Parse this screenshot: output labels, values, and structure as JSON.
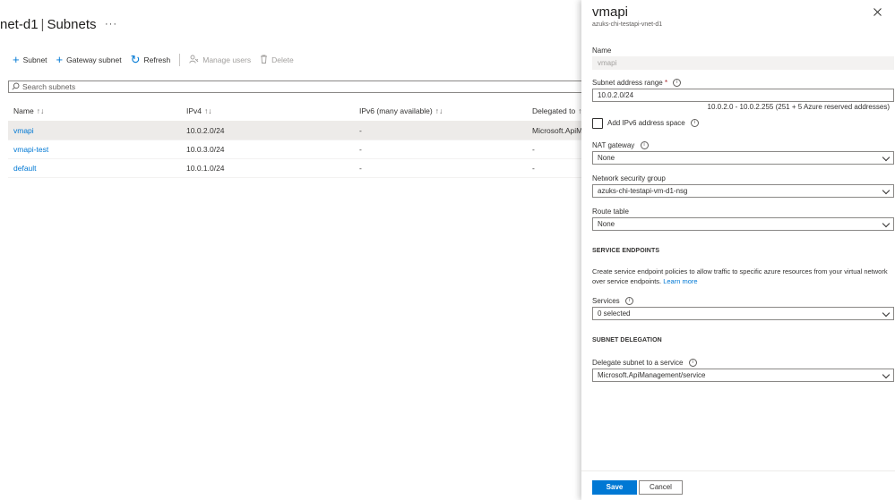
{
  "page": {
    "title_part1": "net-d1",
    "title_sep": "|",
    "title_part2": "Subnets",
    "more": "···"
  },
  "toolbar": {
    "subnet": "Subnet",
    "gateway_subnet": "Gateway subnet",
    "refresh": "Refresh",
    "manage_users": "Manage users",
    "delete": "Delete"
  },
  "search": {
    "placeholder": "Search subnets"
  },
  "table": {
    "headers": [
      "Name",
      "IPv4",
      "IPv6 (many available)",
      "Delegated to"
    ],
    "rows": [
      {
        "name": "vmapi",
        "ipv4": "10.0.2.0/24",
        "ipv6": "-",
        "delegated": "Microsoft.ApiM",
        "selected": true
      },
      {
        "name": "vmapi-test",
        "ipv4": "10.0.3.0/24",
        "ipv6": "-",
        "delegated": "-",
        "selected": false
      },
      {
        "name": "default",
        "ipv4": "10.0.1.0/24",
        "ipv6": "-",
        "delegated": "-",
        "selected": false
      }
    ]
  },
  "panel": {
    "title": "vmapi",
    "subtitle": "azuks-chi-testapi-vnet-d1",
    "name_label": "Name",
    "name_value": "vmapi",
    "range_label": "Subnet address range",
    "range_required": "*",
    "range_value": "10.0.2.0/24",
    "range_hint": "10.0.2.0 - 10.0.2.255 (251 + 5 Azure reserved addresses)",
    "ipv6_label": "Add IPv6 address space",
    "nat_label": "NAT gateway",
    "nat_value": "None",
    "nsg_label": "Network security group",
    "nsg_value": "azuks-chi-testapi-vm-d1-nsg",
    "route_label": "Route table",
    "route_value": "None",
    "endpoints_heading": "SERVICE ENDPOINTS",
    "endpoints_desc": "Create service endpoint policies to allow traffic to specific azure resources from your virtual network over service endpoints.",
    "learn_more": "Learn more",
    "services_label": "Services",
    "services_value": "0 selected",
    "delegation_heading": "SUBNET DELEGATION",
    "delegate_label": "Delegate subnet to a service",
    "delegate_value": "Microsoft.ApiManagement/service",
    "save": "Save",
    "cancel": "Cancel"
  },
  "colors": {
    "accent": "#0078d4",
    "selected_row": "#edebe9",
    "required": "#a4262c"
  }
}
